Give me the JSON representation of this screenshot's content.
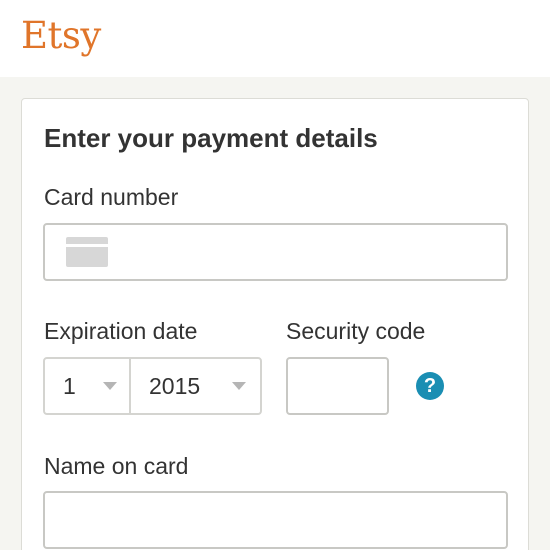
{
  "header": {
    "logo_text": "Etsy"
  },
  "payment": {
    "title": "Enter your payment details",
    "card_number_label": "Card number",
    "card_number_value": "",
    "expiration_label": "Expiration date",
    "expiration_month": "1",
    "expiration_year": "2015",
    "security_code_label": "Security code",
    "security_code_value": "",
    "help_symbol": "?",
    "name_on_card_label": "Name on card",
    "name_on_card_value": ""
  },
  "colors": {
    "brand": "#e0752a",
    "help_icon": "#1a8eb3",
    "background": "#f5f5f1"
  },
  "icons": [
    "credit-card-icon",
    "chevron-down-icon",
    "help-icon"
  ]
}
